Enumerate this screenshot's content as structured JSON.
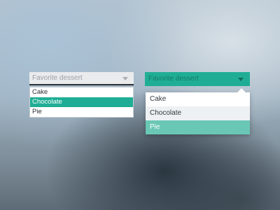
{
  "colors": {
    "accent": "#1fae95",
    "accent_light": "#6ac7b5",
    "dark_caret": "#126b5b"
  },
  "left_dropdown": {
    "placeholder": "Favorite dessert",
    "caret_icon": "chevron-down-icon",
    "options": [
      "Cake",
      "Chocolate",
      "Pie"
    ],
    "selected": "Chocolate"
  },
  "right_dropdown": {
    "placeholder": "Favorite dessert",
    "caret_icon": "chevron-down-icon",
    "options": [
      "Cake",
      "Chocolate",
      "Pie"
    ],
    "selected": "Pie"
  }
}
